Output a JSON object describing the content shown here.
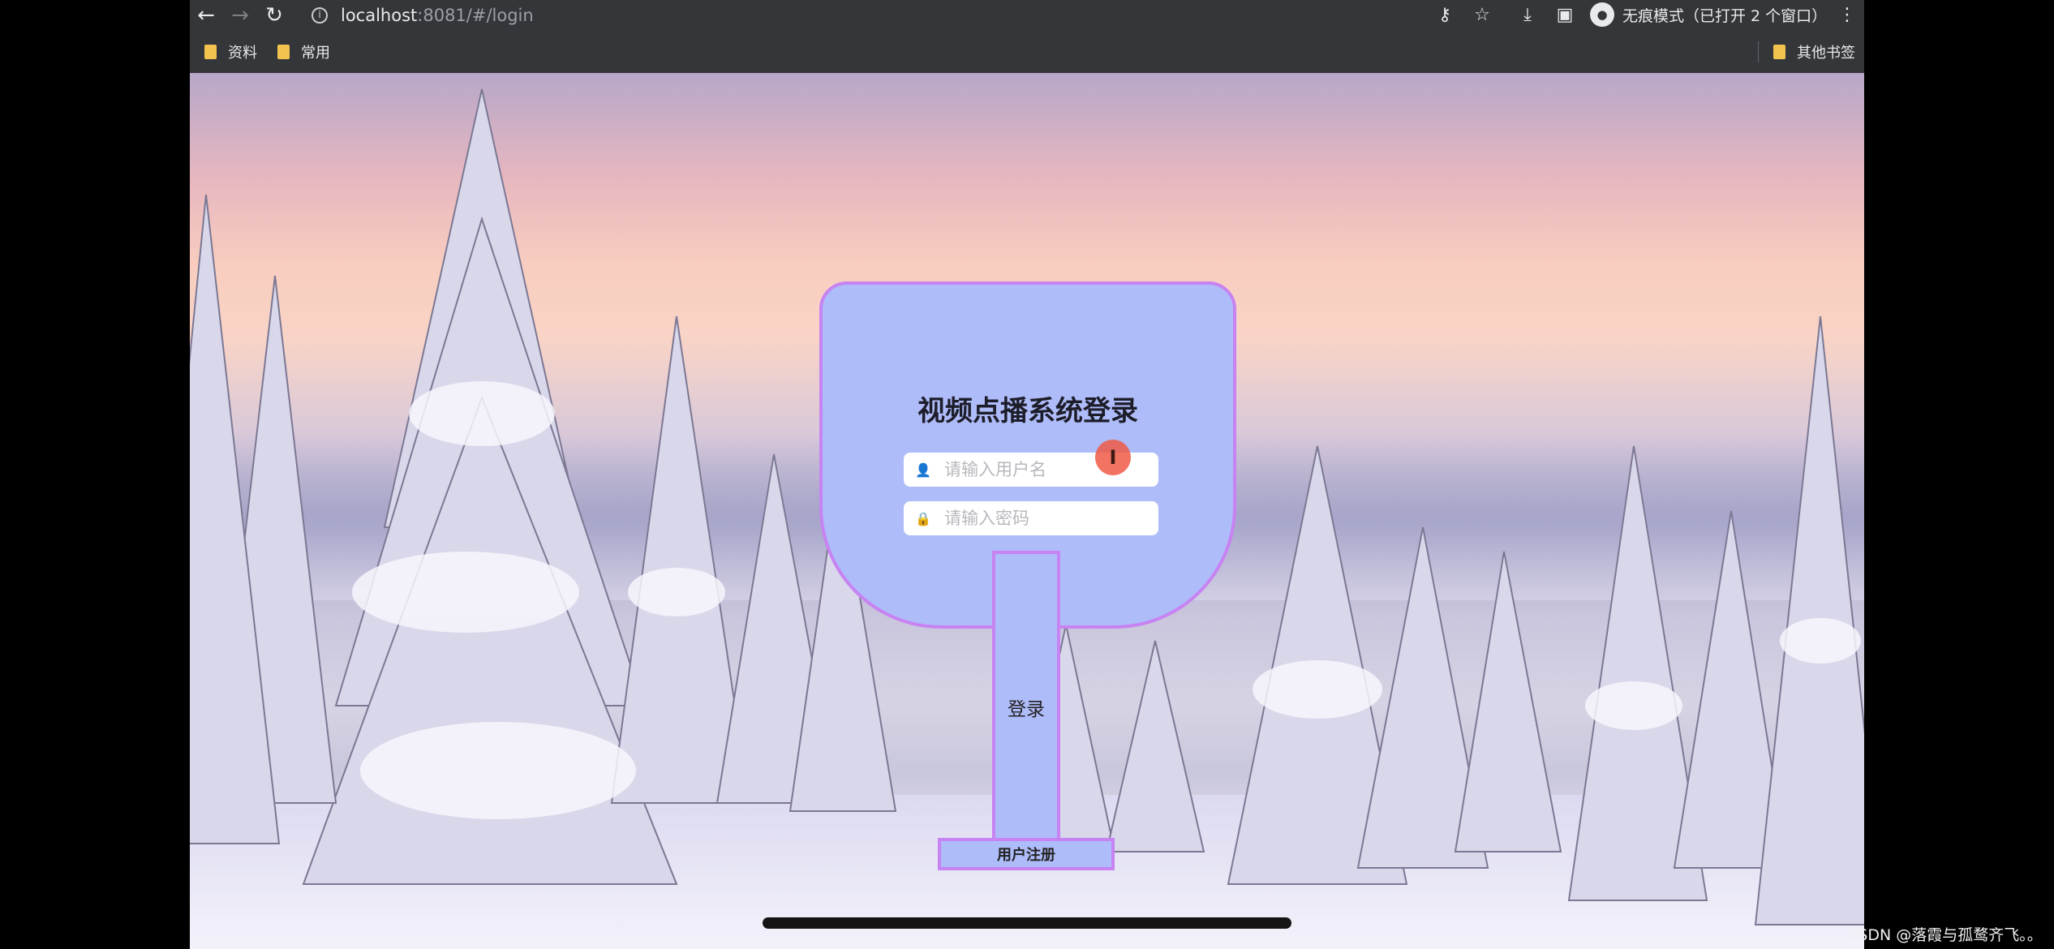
{
  "browser": {
    "url_host": "localhost",
    "url_rest": ":8081/#/login",
    "incognito_label": "无痕模式（已打开 2 个窗口）",
    "icons": {
      "back": "back-arrow-icon",
      "forward": "forward-arrow-icon",
      "reload": "reload-icon",
      "info": "info-icon",
      "key": "key-icon",
      "star": "star-icon",
      "download": "download-icon",
      "sidepanel": "side-panel-icon",
      "incognito": "incognito-icon",
      "menu": "kebab-menu-icon"
    }
  },
  "bookmarks": {
    "items": [
      "资料",
      "常用"
    ],
    "other": "其他书签"
  },
  "login": {
    "title": "视频点播系统登录",
    "username_placeholder": "请输入用户名",
    "password_placeholder": "请输入密码",
    "login_label": "登录",
    "register_label": "用户注册"
  },
  "colors": {
    "card_fill": "#aebcf9",
    "card_border": "#c783f2",
    "cursor_highlight": "#f05a46"
  },
  "watermark": "CSDN @落霞与孤鹜齐飞。。"
}
